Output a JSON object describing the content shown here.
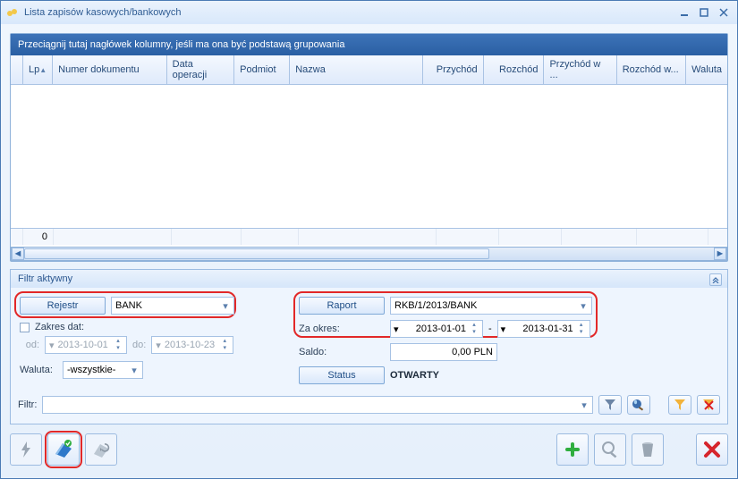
{
  "window": {
    "title": "Lista zapisów kasowych/bankowych"
  },
  "grid": {
    "group_hint": "Przeciągnij tutaj nagłówek kolumny, jeśli ma ona być podstawą grupowania",
    "columns": {
      "lp": "Lp",
      "numer": "Numer dokumentu",
      "data": "Data operacji",
      "podmiot": "Podmiot",
      "nazwa": "Nazwa",
      "przychod": "Przychód",
      "rozchod": "Rozchód",
      "przychod_w": "Przychód w ...",
      "rozchod_w": "Rozchód w...",
      "waluta": "Waluta"
    },
    "footer": {
      "lp": "0"
    }
  },
  "filter": {
    "title": "Filtr aktywny",
    "rejestr_btn": "Rejestr",
    "rejestr_value": "BANK",
    "zakres_dat_label": "Zakres dat:",
    "od_label": "od:",
    "od_value": "2013-10-01",
    "do_label": "do:",
    "do_value": "2013-10-23",
    "waluta_label": "Waluta:",
    "waluta_value": "-wszystkie-",
    "raport_btn": "Raport",
    "raport_value": "RKB/1/2013/BANK",
    "za_okres_label": "Za okres:",
    "okres_od": "2013-01-01",
    "okres_sep": "-",
    "okres_do": "2013-01-31",
    "saldo_label": "Saldo:",
    "saldo_value": "0,00 PLN",
    "status_btn": "Status",
    "status_value": "OTWARTY",
    "filtr_label": "Filtr:"
  }
}
